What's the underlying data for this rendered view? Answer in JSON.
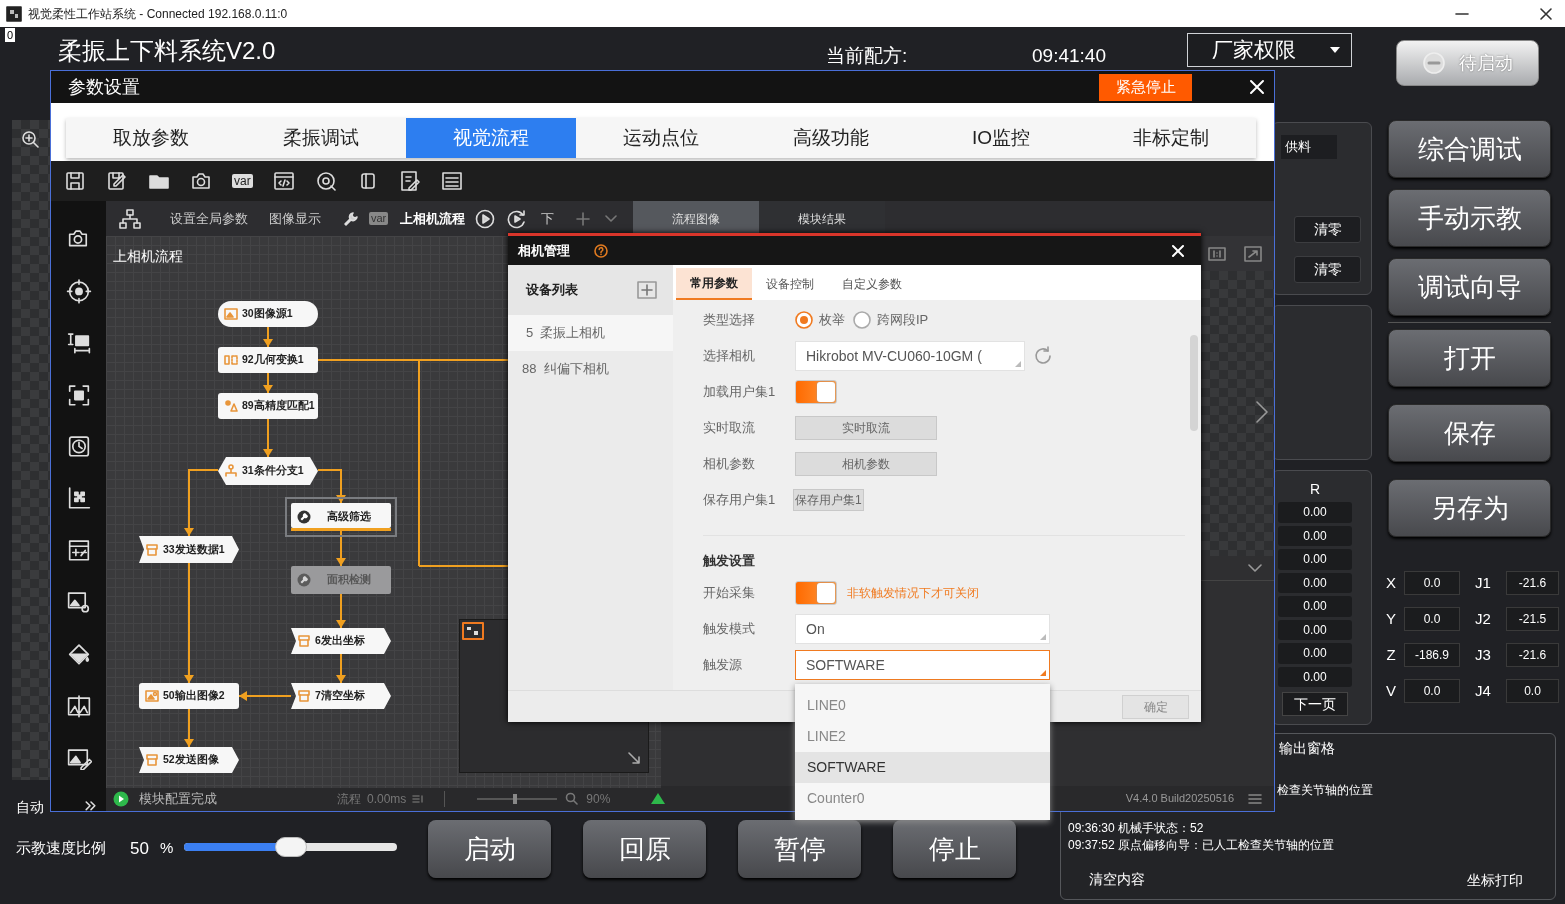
{
  "window": {
    "title": "视觉柔性工作站系统 - Connected 192.168.0.11:0",
    "corner_label": "0"
  },
  "header": {
    "app_title": "柔振上下料系统V2.0",
    "recipe_label": "当前配方:",
    "time": "09:41:40",
    "permission": "厂家权限",
    "run_state": "待启动"
  },
  "side_panel": {
    "feed": "供料",
    "clear_buttons": [
      "清零",
      "清零"
    ],
    "r_header": "R",
    "r_values": [
      "0.00",
      "0.00",
      "0.00",
      "0.00",
      "0.00",
      "0.00",
      "0.00",
      "0.00"
    ],
    "next_page": "下一页"
  },
  "debug_buttons": [
    "综合调试",
    "手动示教",
    "调试向导"
  ],
  "file_buttons": [
    "打开",
    "保存",
    "另存为"
  ],
  "coordinates": [
    {
      "axis": "X",
      "value": "0.0",
      "joint": "J1",
      "joint_value": "-21.6"
    },
    {
      "axis": "Y",
      "value": "0.0",
      "joint": "J2",
      "joint_value": "-21.5"
    },
    {
      "axis": "Z",
      "value": "-186.9",
      "joint": "J3",
      "joint_value": "-21.6"
    },
    {
      "axis": "V",
      "value": "0.0",
      "joint": "J4",
      "joint_value": "0.0"
    }
  ],
  "output_pane": {
    "title": "输出窗格",
    "lines": [
      {
        "text": "检查关节轴的位置"
      },
      {
        "time": "09:36:30",
        "text": "机械手状态：52"
      },
      {
        "time": "09:37:52",
        "text": "原点偏移向导：已人工检查关节轴的位置"
      }
    ],
    "clear": "清空内容",
    "print": "坐标打印"
  },
  "mode": "自动",
  "speed": {
    "label": "示教速度比例",
    "value": "50",
    "unit": "%",
    "level": 0.5
  },
  "controls": [
    "启动",
    "回原",
    "暂停",
    "停止"
  ],
  "param_dialog": {
    "title": "参数设置",
    "estop": "紧急停止",
    "tabs": [
      {
        "label": "取放参数",
        "selected": false
      },
      {
        "label": "柔振调试",
        "selected": false
      },
      {
        "label": "视觉流程",
        "selected": true
      },
      {
        "label": "运动点位",
        "selected": false
      },
      {
        "label": "高级功能",
        "selected": false
      },
      {
        "label": "IO监控",
        "selected": false
      },
      {
        "label": "非标定制",
        "selected": false
      }
    ],
    "toolbar_var": "var",
    "subtoolbar": {
      "global_params": "设置全局参数",
      "image_display": "图像显示",
      "var": "var",
      "current_flow": "上相机流程",
      "other_flow": "下"
    },
    "view_tabs": [
      {
        "label": "流程图像",
        "selected": true
      },
      {
        "label": "模块结果",
        "selected": false
      }
    ],
    "flow": {
      "title": "上相机流程",
      "nodes": [
        {
          "label": "30图像源1",
          "kind": "source",
          "selected": false,
          "disabled": false
        },
        {
          "label": "92几何变换1",
          "kind": "transform",
          "selected": false,
          "disabled": false
        },
        {
          "label": "89高精度匹配1",
          "kind": "match",
          "selected": false,
          "disabled": false
        },
        {
          "label": "31条件分支1",
          "kind": "branch",
          "selected": false,
          "disabled": false
        },
        {
          "label": "高级筛选",
          "kind": "tool",
          "selected": true,
          "disabled": false
        },
        {
          "label": "33发送数据1",
          "kind": "send",
          "selected": false,
          "disabled": false
        },
        {
          "label": "面积检测",
          "kind": "tool",
          "selected": false,
          "disabled": true
        },
        {
          "label": "6发出坐标",
          "kind": "send",
          "selected": false,
          "disabled": false
        },
        {
          "label": "7清空坐标",
          "kind": "send",
          "selected": false,
          "disabled": false
        },
        {
          "label": "50输出图像2",
          "kind": "output",
          "selected": false,
          "disabled": false
        },
        {
          "label": "52发送图像",
          "kind": "send",
          "selected": false,
          "disabled": false
        }
      ]
    },
    "status": {
      "message": "模块配置完成",
      "timing_label": "流程",
      "timing_value": "0.00ms",
      "zoom": "90%",
      "version": "V4.4.0 Build20250516"
    }
  },
  "camera_dialog": {
    "title": "相机管理",
    "device_list_title": "设备列表",
    "devices": [
      {
        "index": "5",
        "name": "柔振上相机",
        "selected": true
      },
      {
        "index": "88",
        "name": "纠偏下相机",
        "selected": false
      }
    ],
    "tabs": [
      {
        "label": "常用参数",
        "selected": true
      },
      {
        "label": "设备控制",
        "selected": false
      },
      {
        "label": "自定义参数",
        "selected": false
      }
    ],
    "rows": [
      {
        "kind": "radio",
        "label": "类型选择",
        "options": [
          {
            "label": "枚举",
            "selected": true
          },
          {
            "label": "跨网段IP",
            "selected": false
          }
        ]
      },
      {
        "kind": "select_refresh",
        "label": "选择相机",
        "value": "Hikrobot MV-CU060-10GM (",
        "open": false
      },
      {
        "kind": "toggle",
        "label": "加载用户集1",
        "on": true
      },
      {
        "kind": "button",
        "label": "实时取流",
        "button": "实时取流"
      },
      {
        "kind": "button",
        "label": "相机参数",
        "button": "相机参数"
      },
      {
        "kind": "small_button",
        "label": "保存用户集1",
        "button": "保存用户集1"
      },
      {
        "kind": "section",
        "label": "触发设置"
      },
      {
        "kind": "toggle",
        "label": "开始采集",
        "on": true,
        "hint": "非软触发情况下才可关闭"
      },
      {
        "kind": "select",
        "label": "触发模式",
        "value": "On",
        "open": false
      },
      {
        "kind": "select",
        "label": "触发源",
        "value": "SOFTWARE",
        "open": true,
        "options": [
          {
            "label": "LINE0",
            "selected": false
          },
          {
            "label": "LINE2",
            "selected": false
          },
          {
            "label": "SOFTWARE",
            "selected": true
          },
          {
            "label": "Counter0",
            "selected": false
          }
        ]
      }
    ],
    "ok": "确定"
  }
}
